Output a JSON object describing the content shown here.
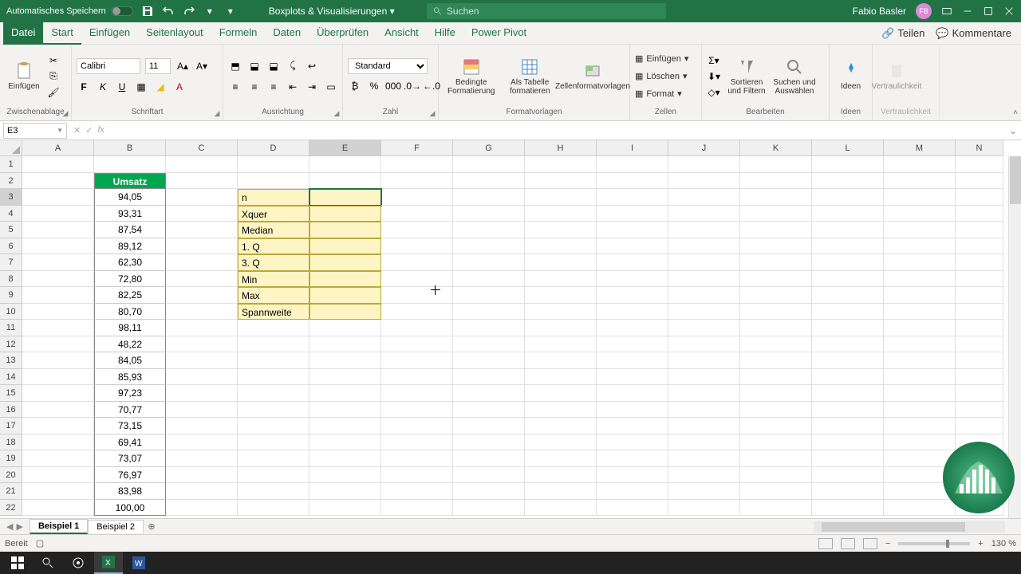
{
  "titlebar": {
    "autosave": "Automatisches Speichern",
    "doc_title": "Boxplots & Visualisierungen",
    "search_placeholder": "Suchen",
    "user_name": "Fabio Basler",
    "user_initials": "FB"
  },
  "tabs": {
    "datei": "Datei",
    "start": "Start",
    "einfuegen": "Einfügen",
    "seitenlayout": "Seitenlayout",
    "formeln": "Formeln",
    "daten": "Daten",
    "ueberpruefen": "Überprüfen",
    "ansicht": "Ansicht",
    "hilfe": "Hilfe",
    "powerpivot": "Power Pivot",
    "teilen": "Teilen",
    "kommentare": "Kommentare"
  },
  "ribbon": {
    "einfuegen": "Einfügen",
    "zwischenablage": "Zwischenablage",
    "schriftart": "Schriftart",
    "font_name": "Calibri",
    "font_size": "11",
    "ausrichtung": "Ausrichtung",
    "zahl": "Zahl",
    "numformat": "Standard",
    "formatvorlagen": "Formatvorlagen",
    "bedingte": "Bedingte Formatierung",
    "alstabelle": "Als Tabelle formatieren",
    "zellenfv": "Zellenformatvorlagen",
    "zellen": "Zellen",
    "zellen_einfuegen": "Einfügen",
    "zellen_loeschen": "Löschen",
    "zellen_format": "Format",
    "bearbeiten": "Bearbeiten",
    "sortieren": "Sortieren und Filtern",
    "suchen": "Suchen und Auswählen",
    "ideen": "Ideen",
    "ideen_g": "Ideen",
    "vertraulich": "Vertraulichkeit",
    "vertraulich_g": "Vertraulichkeit"
  },
  "namebox": "E3",
  "columns": [
    "A",
    "B",
    "C",
    "D",
    "E",
    "F",
    "G",
    "H",
    "I",
    "J",
    "K",
    "L",
    "M",
    "N"
  ],
  "rows": [
    "1",
    "2",
    "3",
    "4",
    "5",
    "6",
    "7",
    "8",
    "9",
    "10",
    "11",
    "12",
    "13",
    "14",
    "15",
    "16",
    "17",
    "18",
    "19",
    "20",
    "21",
    "22"
  ],
  "umsatz_header": "Umsatz",
  "umsatz": [
    "94,05",
    "93,31",
    "87,54",
    "89,12",
    "62,30",
    "72,80",
    "82,25",
    "80,70",
    "98,11",
    "48,22",
    "84,05",
    "85,93",
    "97,23",
    "70,77",
    "73,15",
    "69,41",
    "73,07",
    "76,97",
    "83,98",
    "100,00"
  ],
  "stats": [
    "n",
    "Xquer",
    "Median",
    "1. Q",
    "3. Q",
    "Min",
    "Max",
    "Spannweite"
  ],
  "sheets": {
    "s1": "Beispiel 1",
    "s2": "Beispiel 2"
  },
  "status": {
    "ready": "Bereit",
    "zoom": "130 %"
  }
}
